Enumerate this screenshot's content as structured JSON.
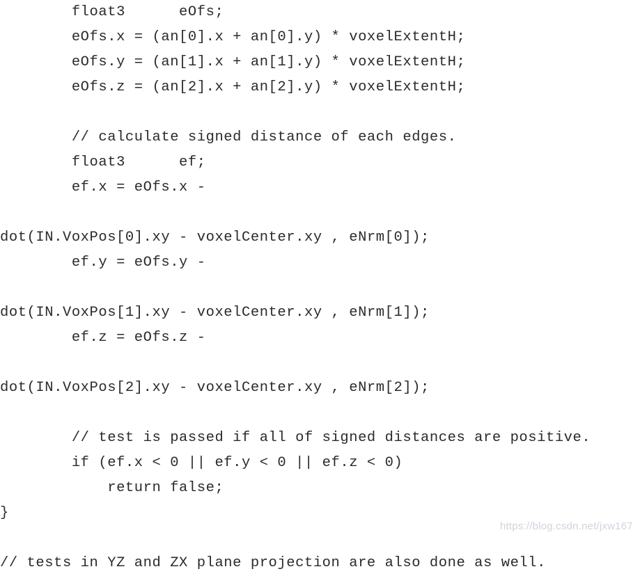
{
  "document": {
    "type": "source-code-snippet",
    "language": "hlsl",
    "background_color": "#ffffff",
    "text_color": "#2b2b2b",
    "lines": [
      "        float3      eOfs;",
      "        eOfs.x = (an[0].x + an[0].y) * voxelExtentH;",
      "        eOfs.y = (an[1].x + an[1].y) * voxelExtentH;",
      "        eOfs.z = (an[2].x + an[2].y) * voxelExtentH;",
      "",
      "        // calculate signed distance of each edges.",
      "        float3      ef;",
      "        ef.x = eOfs.x -",
      "",
      "dot(IN.VoxPos[0].xy - voxelCenter.xy , eNrm[0]);",
      "        ef.y = eOfs.y -",
      "",
      "dot(IN.VoxPos[1].xy - voxelCenter.xy , eNrm[1]);",
      "        ef.z = eOfs.z -",
      "",
      "dot(IN.VoxPos[2].xy - voxelCenter.xy , eNrm[2]);",
      "",
      "        // test is passed if all of signed distances are positive.",
      "        if (ef.x < 0 || ef.y < 0 || ef.z < 0)",
      "            return false;",
      "}",
      "",
      "// tests in YZ and ZX plane projection are also done as well."
    ]
  },
  "watermark": {
    "text": "https://blog.csdn.net/jxw167",
    "color": "#cfd4dc"
  }
}
